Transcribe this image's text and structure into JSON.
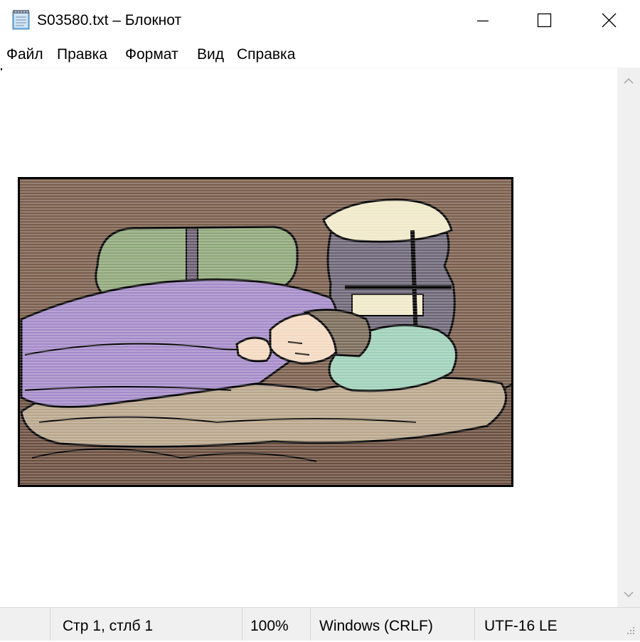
{
  "window": {
    "title": "S03580.txt – Блокнот",
    "icon": "notepad-icon",
    "controls": [
      "minimize-icon",
      "maximize-icon",
      "close-icon"
    ]
  },
  "menu": {
    "items": [
      "Файл",
      "Правка",
      "Формат",
      "Вид",
      "Справка"
    ]
  },
  "editor": {
    "content": "",
    "embedded_image": "sleeping-camper-illustration"
  },
  "scrollbar": {
    "up_icon": "scroll-up-arrow-icon",
    "down_icon": "scroll-down-arrow-icon"
  },
  "status": {
    "position": "Стр 1, стлб 1",
    "zoom": "100%",
    "line_ending": "Windows (CRLF)",
    "encoding": "UTF-16 LE"
  },
  "colors": {
    "background": "#ffffff",
    "bar": "#f0f0f0",
    "art_brown": "#7a5e4c",
    "art_sleeping_bag": "#a48ac8",
    "art_pillow": "#8ea678",
    "art_shirt": "#9ed0b8",
    "art_backpack": "#6b6576",
    "art_bedroll": "#b8a58a"
  }
}
